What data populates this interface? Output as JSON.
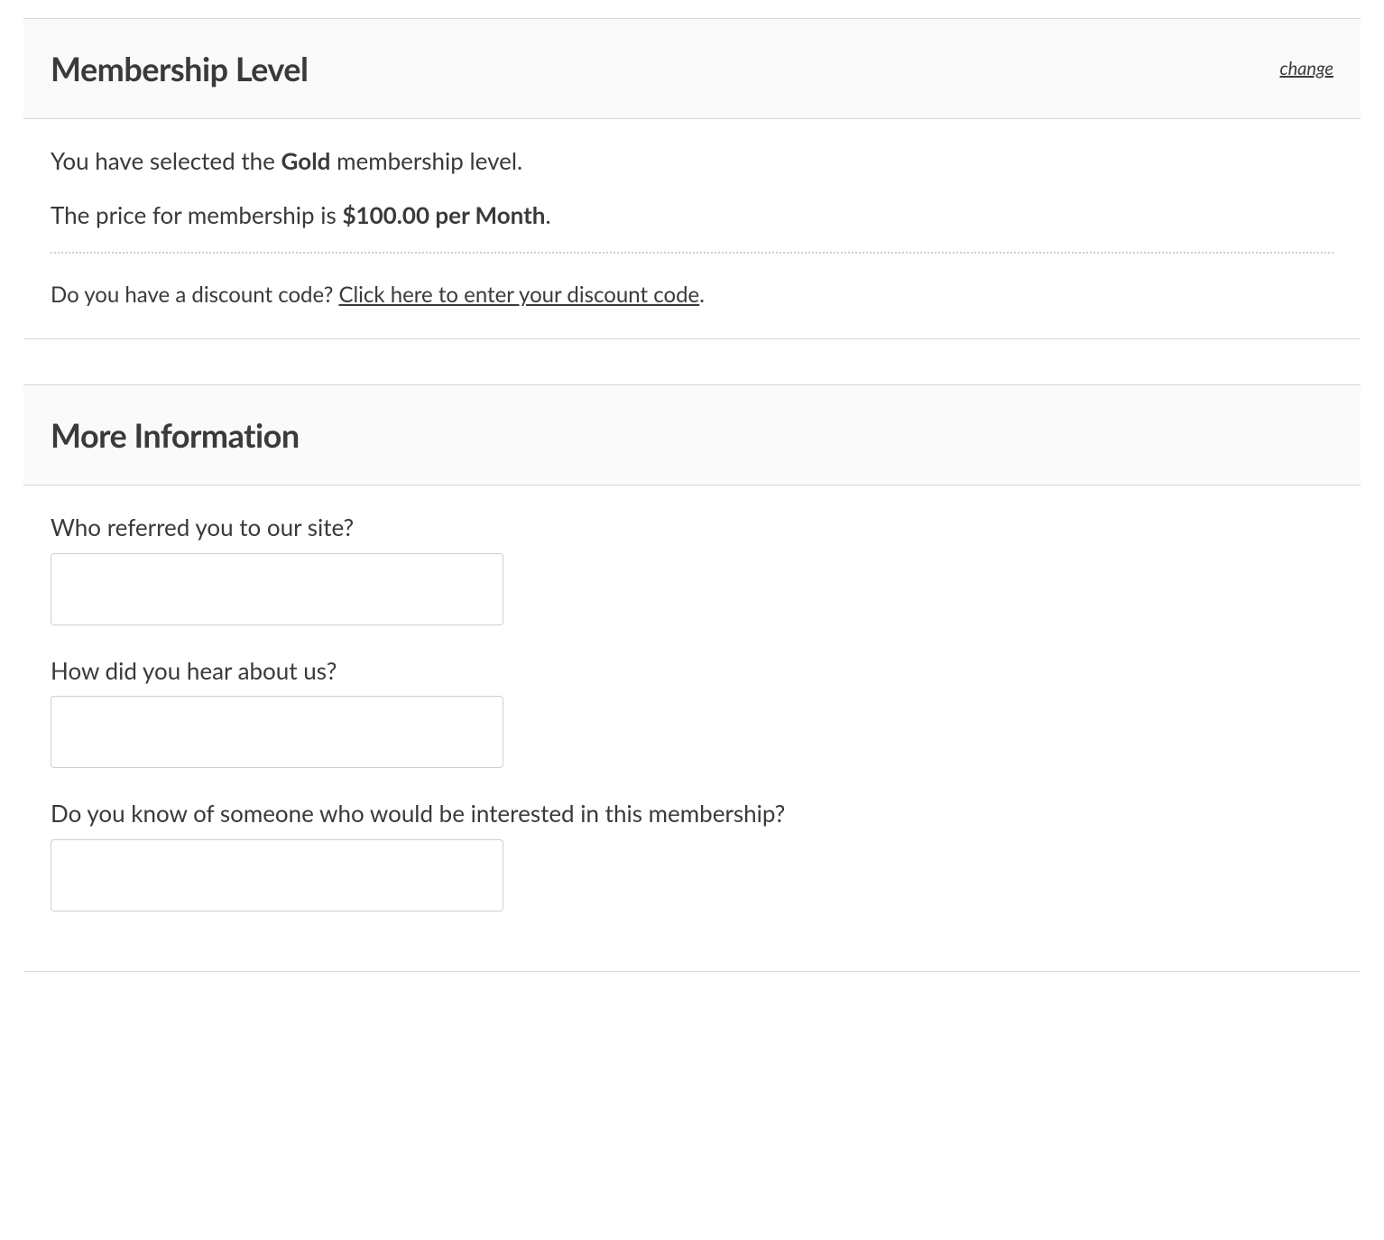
{
  "membership": {
    "section_title": "Membership Level",
    "change_link": "change",
    "selected_prefix": "You have selected the ",
    "level_name": "Gold",
    "selected_suffix": " membership level.",
    "price_prefix": "The price for membership is ",
    "price_value": "$100.00 per Month",
    "price_suffix": ".",
    "discount_question": "Do you have a discount code? ",
    "discount_link": "Click here to enter your discount code",
    "discount_suffix": "."
  },
  "more_info": {
    "section_title": "More Information",
    "fields": {
      "referred": {
        "label": "Who referred you to our site?",
        "value": ""
      },
      "hear_about": {
        "label": "How did you hear about us?",
        "value": ""
      },
      "interested": {
        "label": "Do you know of someone who would be interested in this membership?",
        "value": ""
      }
    }
  }
}
